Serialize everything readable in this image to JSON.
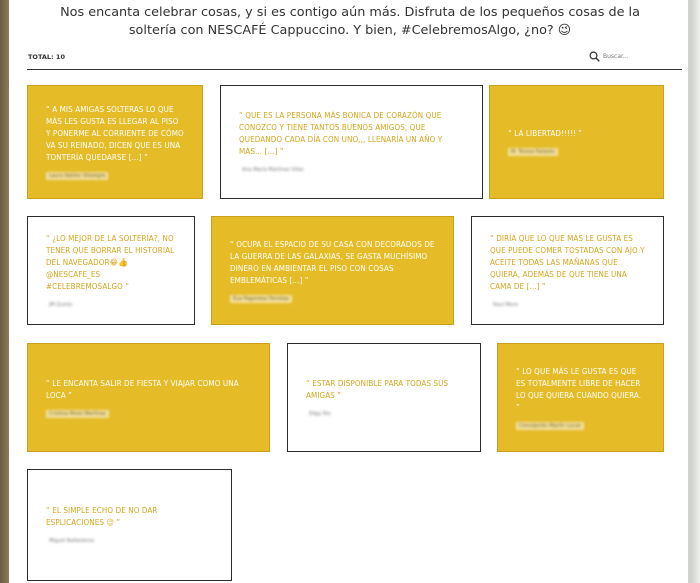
{
  "header": {
    "text": "Nos encanta celebrar cosas, y si es contigo aún más. Disfruta de los pequeños cosas de la soltería con NESCAFÉ Cappuccino. Y bien, #CelebremosAlgo, ¿no? 😉"
  },
  "toolbar": {
    "total": "TOTAL: 10",
    "search_placeholder": "Buscar..."
  },
  "colors": {
    "accent": "#e5bc27",
    "quote_on_white": "#d6a41a"
  },
  "cards": [
    {
      "style": "yellow",
      "quote": "“ A MIS AMIGAS SOLTERAS LO QUE MÁS LES GUSTA ES LLEGAR AL PISO Y PONERME AL CORRIENTE DE CÓMO VA SU REINADO, DICEN QUE ES UNA TONTERÍA QUEDARSE [...] ”",
      "author": "Laura Ibáñez Villalegre"
    },
    {
      "style": "white",
      "quote": "“ QUE ES LA PERSONA MÁS BONICA DE CORAZÓN QUE CONOZCO Y TIENE TANTOS BUENOS AMIGOS, QUE QUEDANDO CADA DÍA CON UNO,,, LLENARÍA UN AÑO Y MÁS... [...] ”",
      "author": "Ana María Martínez Villar"
    },
    {
      "style": "yellow",
      "quote": "“ LA LIBERTAD!!!!! ”",
      "author": "M. Teresa Pallarés"
    },
    {
      "style": "white",
      "quote": "“ ¿LO MEJOR DE LA SOLTERÍA?, NO TENER QUE BORRAR EL HISTORIAL DEL NAVEGADOR😂👍 @NESCAFE_ES #CELEBREMOSALGO ”",
      "author": "JM Quirós"
    },
    {
      "style": "yellow",
      "quote": "“ OCUPA EL ESPACIO DE SU CASA CON DECORADOS DE LA GUERRA DE LAS GALAXIAS, SE GASTA MUCHÍSIMO DINERO EN AMBIENTAR EL PISO CON COSAS EMBLEMÁTICAS [...] ”",
      "author": "Eva Pagoneso Ferrotas"
    },
    {
      "style": "white",
      "quote": "“ DIRÍA QUE LO QUE MÁS LE GUSTA ES QUE PUEDE COMER TOSTADAS CON AJO Y ACEITE TODAS LAS MAÑANAS QUE QUIERA, ADEMÁS DE QUE TIENE UNA CAMA DE [...] ”",
      "author": "Raul Mora"
    },
    {
      "style": "yellow",
      "quote": "“ LE ENCANTA SALIR DE FIESTA Y VIAJAR COMO UNA LOCA ”",
      "author": "Cristina Pérez Martínez"
    },
    {
      "style": "white",
      "quote": "“ ESTAR DISPONIBLE PARA TODAS SUS AMIGAS ”",
      "author": "Edgy Rio"
    },
    {
      "style": "yellow",
      "quote": "“ LO QUE MÁS LE GUSTA ES QUE ES TOTALMENTE LIBRE DE HACER LO QUE QUIERA CUANDO QUIERA. ”",
      "author": "Concepción Martín Lucas"
    },
    {
      "style": "white",
      "quote": "“ EL SIMPLE ECHO DE NO DAR ESPLICACIONES 😉 ”",
      "author": "Miguel Ballesteros"
    }
  ]
}
